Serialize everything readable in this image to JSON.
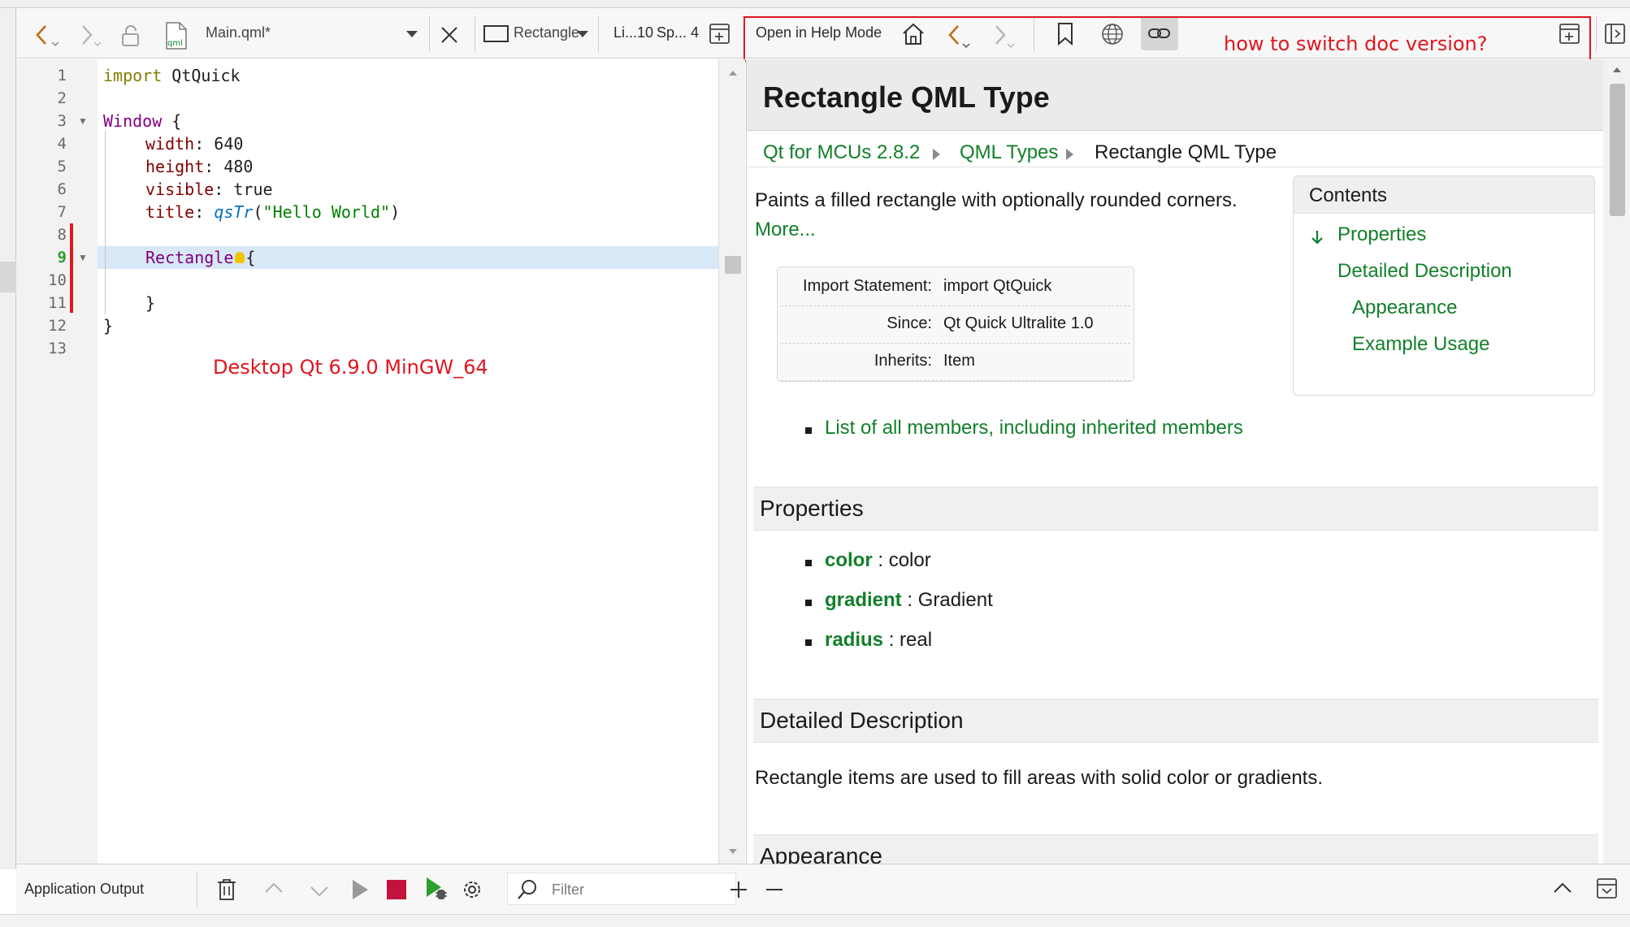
{
  "editor_toolbar": {
    "file_name": "Main.qml*",
    "file_icon_text": "qml",
    "symbol": "Rectangle",
    "position": "Li...10",
    "spaces": "Sp... 4"
  },
  "help_toolbar": {
    "open_in_help_mode": "Open in Help Mode"
  },
  "annotations": {
    "help_question": "how to switch doc version?",
    "kit_note": "Desktop Qt 6.9.0 MinGW_64"
  },
  "editor": {
    "current_line": 9,
    "line_numbers": [
      "1",
      "2",
      "3",
      "4",
      "5",
      "6",
      "7",
      "8",
      "9",
      "10",
      "11",
      "12",
      "13"
    ],
    "lines": {
      "l1_kw": "import",
      "l1_rest": " QtQuick",
      "l3_ty": "Window",
      "l3_rest": " {",
      "l4_pr": "width",
      "l4_rest": ": 640",
      "l5_pr": "height",
      "l5_rest": ": 480",
      "l6_pr": "visible",
      "l6_rest": ": true",
      "l7_pr": "title",
      "l7_colon": ": ",
      "l7_fn": "qsTr",
      "l7_p1": "(",
      "l7_str": "\"Hello World\"",
      "l7_p2": ")",
      "l9_ty": "Rectangle",
      "l9_rest": "{",
      "l11": "}",
      "l12": "}"
    }
  },
  "help": {
    "title": "Rectangle QML Type",
    "breadcrumbs": [
      "Qt for MCUs 2.8.2",
      "QML Types",
      "Rectangle QML Type"
    ],
    "summary": "Paints a filled rectangle with optionally rounded corners.",
    "more": "More...",
    "import_table": [
      {
        "key": "Import Statement:",
        "value": "import QtQuick"
      },
      {
        "key": "Since:",
        "value": "Qt Quick Ultralite 1.0"
      },
      {
        "key": "Inherits:",
        "value": "Item"
      }
    ],
    "contents": {
      "title": "Contents",
      "items": [
        "Properties",
        "Detailed Description",
        "Appearance",
        "Example Usage"
      ]
    },
    "all_members_link": "List of all members, including inherited members",
    "properties_heading": "Properties",
    "properties": [
      {
        "name": "color",
        "type": " : color"
      },
      {
        "name": "gradient",
        "type": " : Gradient"
      },
      {
        "name": "radius",
        "type": " : real"
      }
    ],
    "detailed_heading": "Detailed Description",
    "detailed_text": "Rectangle items are used to fill areas with solid color or gradients.",
    "appearance_heading": "Appearance"
  },
  "output_pane": {
    "title": "Application Output",
    "filter_placeholder": "Filter"
  },
  "colors": {
    "link_green": "#127f2a",
    "annotation_red": "#e0161f",
    "current_line": "#d8e8f7",
    "stop_red": "#c0143c"
  }
}
